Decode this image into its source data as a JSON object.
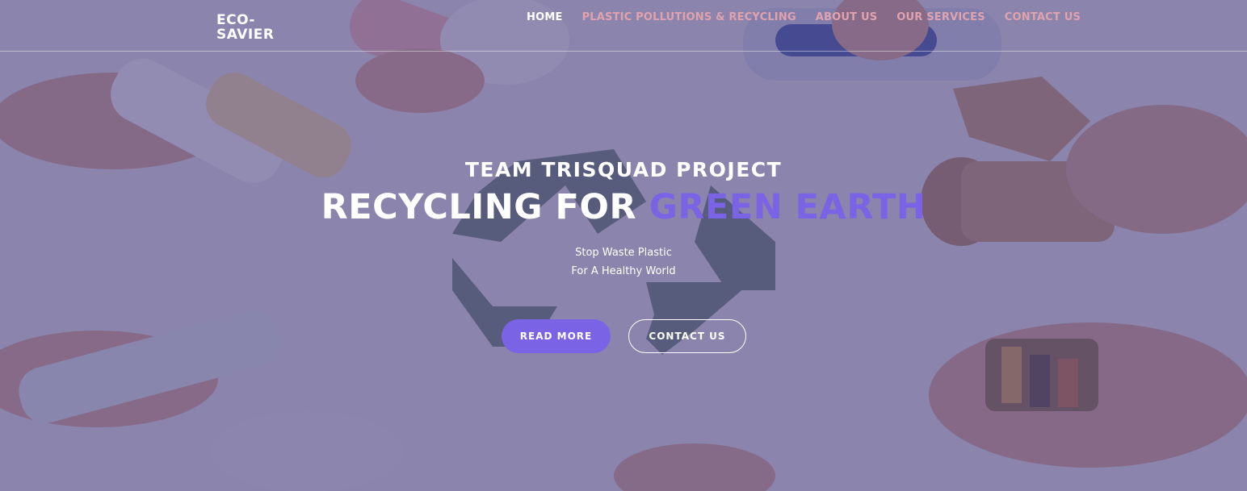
{
  "brand": {
    "logo_line1": "ECO-",
    "logo_line2": "SAVIER"
  },
  "nav": {
    "items": [
      {
        "label": "HOME",
        "active": true
      },
      {
        "label": "PLASTIC POLLUTIONS & RECYCLING",
        "active": false
      },
      {
        "label": "ABOUT US",
        "active": false
      },
      {
        "label": "OUR SERVICES",
        "active": false
      },
      {
        "label": "CONTACT US",
        "active": false
      }
    ]
  },
  "hero": {
    "subtitle": "TEAM TRISQUAD PROJECT",
    "headline_main": "RECYCLING FOR",
    "headline_accent": "GREEN EARTH",
    "tagline_line1": "Stop Waste Plastic",
    "tagline_line2": "For A Healthy World",
    "primary_button": "READ MORE",
    "secondary_button": "CONTACT US"
  },
  "colors": {
    "accent": "#7b63e6",
    "nav_inactive": "#e0a3ae",
    "nav_active": "#ffffff",
    "overlay": "#4a4082"
  },
  "icons": [
    "recycle-symbol-icon"
  ]
}
